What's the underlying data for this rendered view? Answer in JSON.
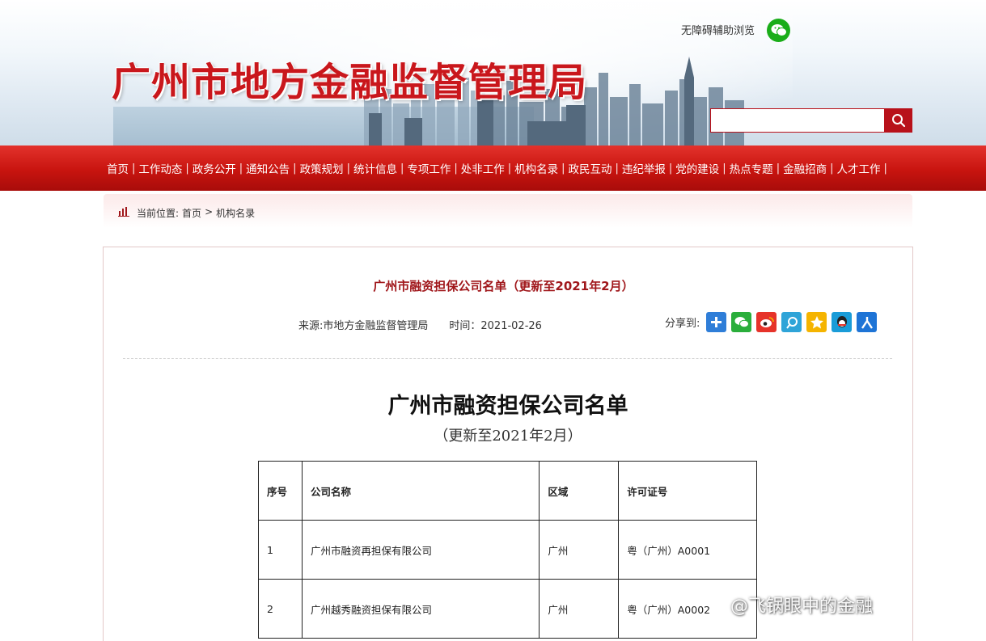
{
  "header": {
    "site_title": "广州市地方金融监督管理局",
    "accessibility_label": "无障碍辅助浏览",
    "search_placeholder": ""
  },
  "nav": {
    "items": [
      "首页",
      "工作动态",
      "政务公开",
      "通知公告",
      "政策规划",
      "统计信息",
      "专项工作",
      "处非工作",
      "机构名录",
      "政民互动",
      "违纪举报",
      "党的建设",
      "热点专题",
      "金融招商",
      "人才工作"
    ],
    "separator": "|"
  },
  "breadcrumb": {
    "prefix": "当前位置:",
    "home": "首页",
    "sep": ">",
    "current": "机构名录"
  },
  "article": {
    "title": "广州市融资担保公司名单（更新至2021年2月）",
    "source": "来源:市地方金融监督管理局",
    "time": "时间：2021-02-26",
    "share_label": "分享到:",
    "share_icons": [
      "plus-share-icon",
      "wechat-share-icon",
      "weibo-share-icon",
      "tencent-weibo-icon",
      "qzone-icon",
      "qq-icon",
      "renren-icon"
    ],
    "doc_title": "广州市融资担保公司名单",
    "doc_subtitle": "（更新至2021年2月）"
  },
  "table": {
    "headers": [
      "序号",
      "公司名称",
      "区域",
      "许可证号"
    ],
    "rows": [
      [
        "1",
        "广州市融资再担保有限公司",
        "广州",
        "粤（广州）A0001"
      ],
      [
        "2",
        "广州越秀融资担保有限公司",
        "广州",
        "粤（广州）A0002"
      ]
    ]
  },
  "watermark": "@飞锅眼中的金融",
  "colors": {
    "brand_red": "#c9171c",
    "nav_red": "#c8140f",
    "title_red": "#a0171b"
  }
}
